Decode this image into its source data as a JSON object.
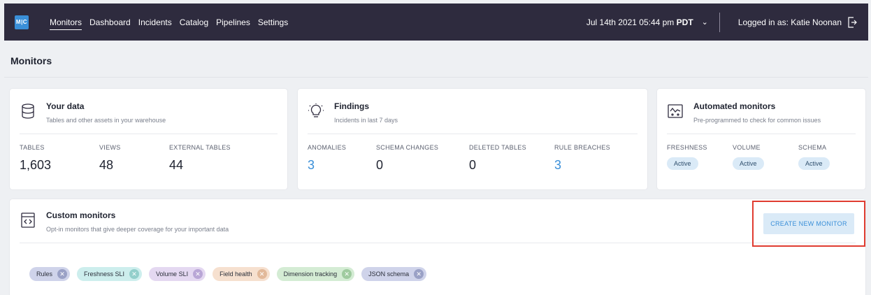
{
  "nav": {
    "logo_text": "M|C",
    "items": [
      "Monitors",
      "Dashboard",
      "Incidents",
      "Catalog",
      "Pipelines",
      "Settings"
    ],
    "date": "Jul 14th 2021 05:44 pm",
    "timezone": "PDT",
    "logged_in": "Logged in as: Katie Noonan"
  },
  "page": {
    "title": "Monitors"
  },
  "your_data": {
    "title": "Your data",
    "subtitle": "Tables and other assets in your warehouse",
    "stats": [
      {
        "label": "TABLES",
        "value": "1,603"
      },
      {
        "label": "VIEWS",
        "value": "48"
      },
      {
        "label": "EXTERNAL TABLES",
        "value": "44"
      }
    ]
  },
  "findings": {
    "title": "Findings",
    "subtitle": "Incidents in last 7 days",
    "stats": [
      {
        "label": "ANOMALIES",
        "value": "3"
      },
      {
        "label": "SCHEMA CHANGES",
        "value": "0"
      },
      {
        "label": "DELETED TABLES",
        "value": "0"
      },
      {
        "label": "RULE BREACHES",
        "value": "3"
      }
    ]
  },
  "automated": {
    "title": "Automated monitors",
    "subtitle": "Pre-programmed to check for common issues",
    "stats": [
      {
        "label": "FRESHNESS",
        "value": "Active"
      },
      {
        "label": "VOLUME",
        "value": "Active"
      },
      {
        "label": "SCHEMA",
        "value": "Active"
      }
    ]
  },
  "custom": {
    "title": "Custom monitors",
    "subtitle": "Opt-in monitors that give deeper coverage for your important data",
    "create_label": "CREATE NEW MONITOR",
    "chips": [
      {
        "label": "Rules",
        "color": "#cfd3ea",
        "x_color": "#9aa1c6"
      },
      {
        "label": "Freshness SLI",
        "color": "#cdeeed",
        "x_color": "#93cfcb"
      },
      {
        "label": "Volume SLI",
        "color": "#e4d8f1",
        "x_color": "#b9a6d6"
      },
      {
        "label": "Field health",
        "color": "#f6e0cf",
        "x_color": "#e2b99a"
      },
      {
        "label": "Dimension tracking",
        "color": "#d4ecd4",
        "x_color": "#9fcb9f"
      },
      {
        "label": "JSON schema",
        "color": "#cfd3ea",
        "x_color": "#9aa1c6"
      }
    ]
  },
  "colors": {
    "nav_bg": "#2e2b3e",
    "accent": "#3a8fd8",
    "highlight": "#e03c31"
  }
}
